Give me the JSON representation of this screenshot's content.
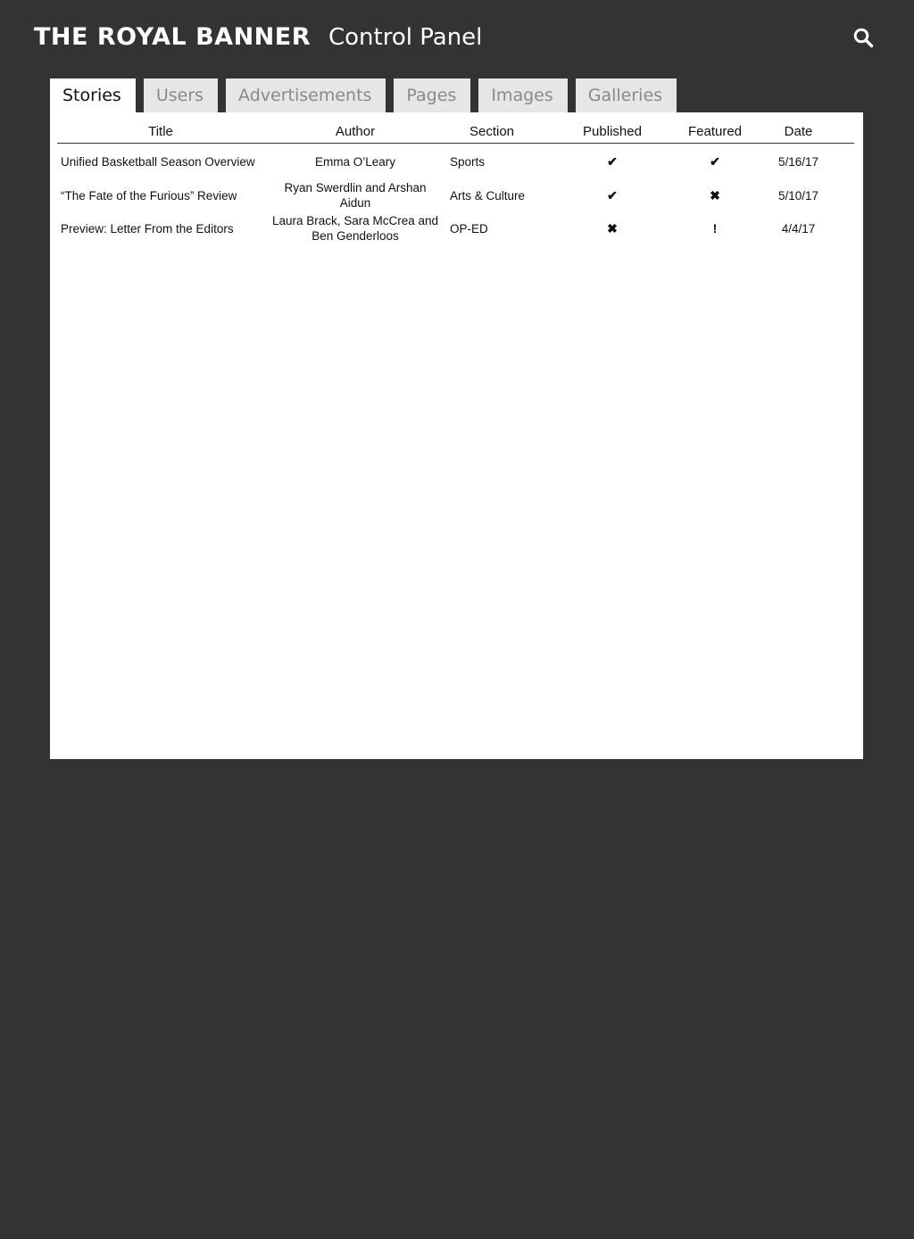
{
  "header": {
    "brand": "THE ROYAL BANNER",
    "title": "Control Panel",
    "search_icon": "search-icon"
  },
  "tabs": [
    {
      "label": "Stories",
      "active": true
    },
    {
      "label": "Users",
      "active": false
    },
    {
      "label": "Advertisements",
      "active": false
    },
    {
      "label": "Pages",
      "active": false
    },
    {
      "label": "Images",
      "active": false
    },
    {
      "label": "Galleries",
      "active": false
    }
  ],
  "table": {
    "columns": [
      "Title",
      "Author",
      "Section",
      "Published",
      "Featured",
      "Date"
    ],
    "rows": [
      {
        "title": "Unified Basketball Season Overview",
        "author": "Emma O’Leary",
        "section": "Sports",
        "published": "✔",
        "featured": "✔",
        "date": "5/16/17"
      },
      {
        "title": "“The Fate of the Furious” Review",
        "author": "Ryan Swerdlin and Arshan Aidun",
        "section": "Arts & Culture",
        "published": "✔",
        "featured": "✖",
        "date": "5/10/17"
      },
      {
        "title": "Preview: Letter From the Editors",
        "author": "Laura Brack, Sara McCrea and Ben Genderloos",
        "section": "OP-ED",
        "published": "✖",
        "featured": "!",
        "date": "4/4/17"
      }
    ]
  },
  "colors": {
    "background": "#333333",
    "panel": "#ffffff",
    "tab_inactive": "#e6e6e6",
    "tab_inactive_text": "#8a8a8a"
  }
}
